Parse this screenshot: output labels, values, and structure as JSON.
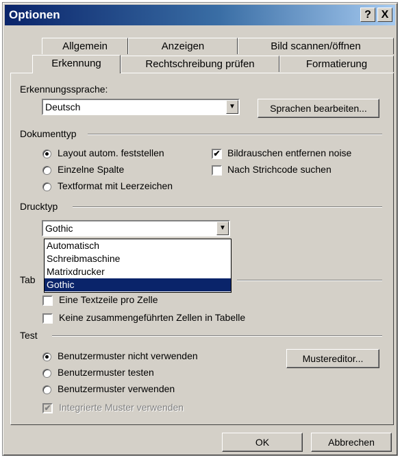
{
  "window": {
    "title": "Optionen",
    "help_button": "?",
    "close_button": "X"
  },
  "tabs": {
    "row_back": [
      "Allgemein",
      "Anzeigen",
      "Bild scannen/öffnen"
    ],
    "row_front": [
      "Erkennung",
      "Rechtschreibung prüfen",
      "Formatierung"
    ],
    "active": "Erkennung"
  },
  "recognition_language": {
    "label": "Erkennungssprache:",
    "value": "Deutsch",
    "edit_button": "Sprachen bearbeiten..."
  },
  "document_type": {
    "group_label": "Dokumenttyp",
    "radios": [
      {
        "label": "Layout autom. feststellen",
        "checked": true
      },
      {
        "label": "Einzelne Spalte",
        "checked": false
      },
      {
        "label": "Textformat mit Leerzeichen",
        "checked": false
      }
    ],
    "checks": [
      {
        "label": "Bildrauschen entfernen noise",
        "checked": true
      },
      {
        "label": "Nach Strichcode suchen",
        "checked": false
      }
    ]
  },
  "print_type": {
    "group_label": "Drucktyp",
    "value": "Gothic",
    "options": [
      "Automatisch",
      "Schreibmaschine",
      "Matrixdrucker",
      "Gothic"
    ],
    "selected": "Gothic"
  },
  "table": {
    "group_label_partial": "Tab",
    "checks": [
      {
        "label": "Eine Textzeile pro Zelle",
        "checked": false
      },
      {
        "label": "Keine zusammengeführten Zellen in Tabelle",
        "checked": false
      }
    ]
  },
  "test": {
    "group_label": "Test",
    "radios": [
      {
        "label": "Benutzermuster nicht verwenden",
        "checked": true
      },
      {
        "label": "Benutzermuster testen",
        "checked": false
      },
      {
        "label": "Benutzermuster verwenden",
        "checked": false
      }
    ],
    "editor_button": "Mustereditor...",
    "integrated": {
      "label": "Integrierte Muster verwenden",
      "checked": true,
      "disabled": true
    }
  },
  "footer": {
    "ok": "OK",
    "cancel": "Abbrechen"
  }
}
